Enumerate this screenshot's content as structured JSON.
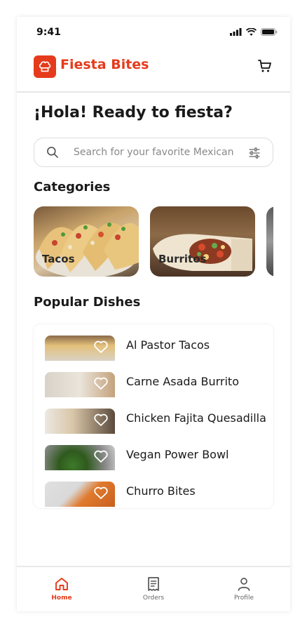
{
  "status_bar": {
    "time": "9:41"
  },
  "header": {
    "app_title": "Fiesta Bites"
  },
  "greeting": "¡Hola! Ready to fiesta?",
  "search": {
    "placeholder": "Search for your favorite Mexican food"
  },
  "categories": {
    "title": "Categories",
    "items": [
      {
        "label": "Tacos"
      },
      {
        "label": "Burritos"
      }
    ]
  },
  "popular": {
    "title": "Popular Dishes",
    "items": [
      {
        "name": "Al Pastor Tacos"
      },
      {
        "name": "Carne Asada Burrito"
      },
      {
        "name": "Chicken Fajita Quesadilla"
      },
      {
        "name": "Vegan Power Bowl"
      },
      {
        "name": "Churro Bites"
      }
    ]
  },
  "bottom_nav": {
    "items": [
      {
        "label": "Home",
        "icon": "home-icon",
        "active": true
      },
      {
        "label": "Orders",
        "icon": "receipt-icon",
        "active": false
      },
      {
        "label": "Profile",
        "icon": "user-icon",
        "active": false
      }
    ]
  },
  "colors": {
    "brand": "#e53b1c",
    "text": "#1a1a1a",
    "muted": "#666666"
  }
}
